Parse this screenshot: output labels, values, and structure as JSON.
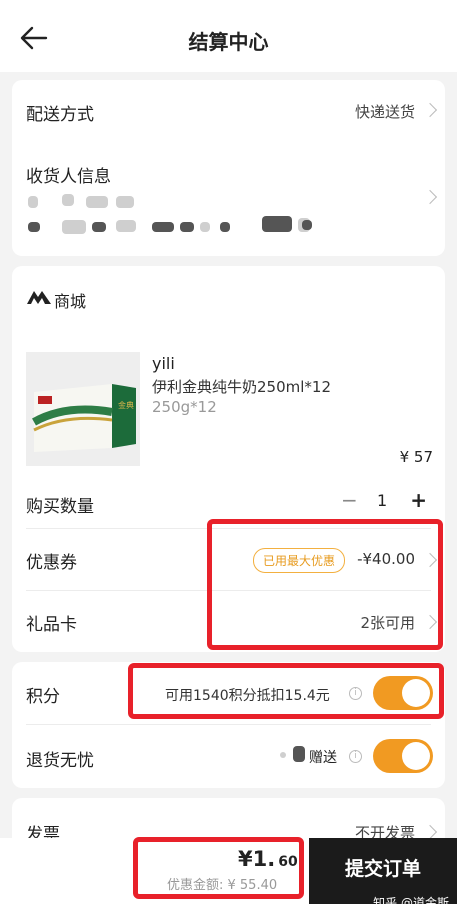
{
  "header": {
    "title": "结算中心"
  },
  "delivery": {
    "label": "配送方式",
    "value": "快递送货"
  },
  "recipient": {
    "label": "收货人信息"
  },
  "store": {
    "name": "商城"
  },
  "product": {
    "brand": "yili",
    "name": "伊利金典纯牛奶250ml*12",
    "spec": "250g*12",
    "price": "¥ 57"
  },
  "quantity": {
    "label": "购买数量",
    "value": "1"
  },
  "coupon": {
    "label": "优惠券",
    "tag": "已用最大优惠",
    "value": "-¥40.00"
  },
  "giftcard": {
    "label": "礼品卡",
    "value": "2张可用"
  },
  "points": {
    "label": "积分",
    "value": "可用1540积分抵扣15.4元",
    "enabled": true
  },
  "returns": {
    "label": "退货无忧",
    "value": "赠送",
    "enabled": true
  },
  "invoice": {
    "label": "发票",
    "value": "不开发票"
  },
  "footer": {
    "total": "¥1.",
    "total_decimal": "60",
    "discount": "优惠金额: ¥ 55.40",
    "submit": "提交订单",
    "watermark": "知乎 @道金斯"
  },
  "colors": {
    "accent": "#f19a22",
    "highlight": "#e8212a"
  }
}
